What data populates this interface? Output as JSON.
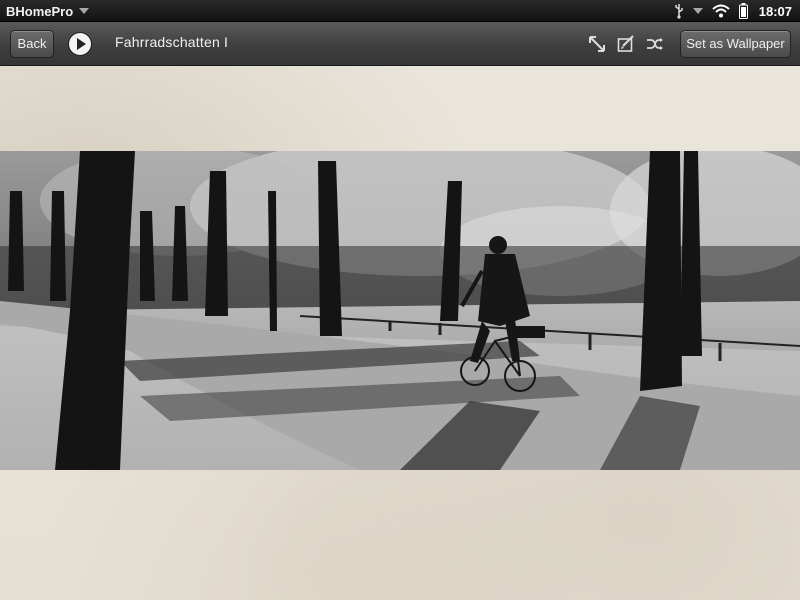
{
  "status_bar": {
    "app_name": "BHomePro",
    "time": "18:07",
    "icons": [
      "app-menu-arrow-icon",
      "usb-icon",
      "usb-menu-arrow-icon",
      "wifi-icon",
      "battery-icon"
    ]
  },
  "toolbar": {
    "back_label": "Back",
    "title": "Fahrradschatten I",
    "wallpaper_label": "Set as Wallpaper",
    "icons": [
      "play-icon",
      "expand-icon",
      "edit-icon",
      "shuffle-icon"
    ]
  },
  "image": {
    "type": "black-and-white photograph",
    "scene": "cyclist riding on a tree-lined park path with long shadows"
  },
  "colors": {
    "toolbar": "#474747",
    "statusbar": "#1a1a1a",
    "backdrop": "#e9e4d8"
  }
}
